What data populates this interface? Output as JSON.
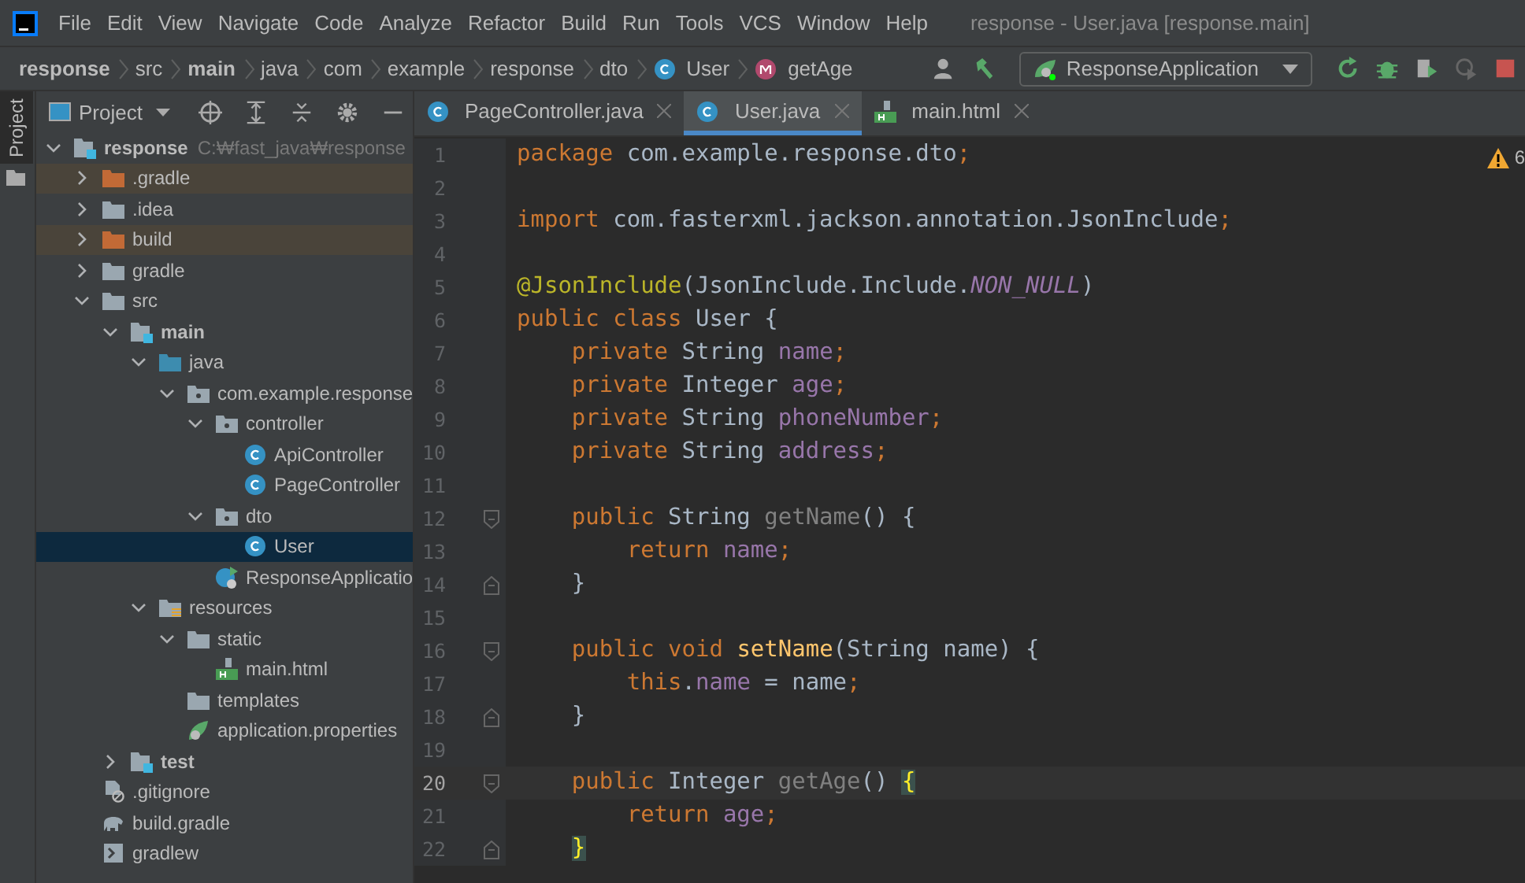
{
  "window": {
    "title": "response - User.java [response.main]"
  },
  "menu": [
    "File",
    "Edit",
    "View",
    "Navigate",
    "Code",
    "Analyze",
    "Refactor",
    "Build",
    "Run",
    "Tools",
    "VCS",
    "Window",
    "Help"
  ],
  "breadcrumbs": [
    {
      "label": "response",
      "bold": true
    },
    {
      "label": "src",
      "bold": false
    },
    {
      "label": "main",
      "bold": true
    },
    {
      "label": "java",
      "bold": false
    },
    {
      "label": "com",
      "bold": false
    },
    {
      "label": "example",
      "bold": false
    },
    {
      "label": "response",
      "bold": false
    },
    {
      "label": "dto",
      "bold": false
    },
    {
      "label": "User",
      "bold": false,
      "kind": "class"
    },
    {
      "label": "getAge",
      "bold": false,
      "kind": "method"
    }
  ],
  "run_config": {
    "label": "ResponseApplication"
  },
  "side_stripe": {
    "label": "Project",
    "selected": true
  },
  "project_panel": {
    "title": "Project",
    "tree": [
      {
        "label": "response",
        "bold": true,
        "hint": "C:₩fast_java₩response",
        "kind": "module",
        "expanded": true,
        "selected": false,
        "excluded": false,
        "children": [
          {
            "label": ".gradle",
            "kind": "folder",
            "excluded": true,
            "expanded": false,
            "selected": false
          },
          {
            "label": ".idea",
            "kind": "folder",
            "excluded": false,
            "expanded": false,
            "selected": false
          },
          {
            "label": "build",
            "kind": "folder",
            "excluded": true,
            "expanded": false,
            "selected": false
          },
          {
            "label": "gradle",
            "kind": "folder",
            "excluded": false,
            "expanded": false,
            "selected": false
          },
          {
            "label": "src",
            "kind": "folder",
            "excluded": false,
            "expanded": true,
            "selected": false,
            "children": [
              {
                "label": "main",
                "bold": true,
                "kind": "module",
                "excluded": false,
                "expanded": true,
                "selected": false,
                "children": [
                  {
                    "label": "java",
                    "kind": "source",
                    "excluded": false,
                    "expanded": true,
                    "selected": false,
                    "children": [
                      {
                        "label": "com.example.response",
                        "kind": "package",
                        "excluded": false,
                        "expanded": true,
                        "selected": false,
                        "children": [
                          {
                            "label": "controller",
                            "kind": "package",
                            "excluded": false,
                            "expanded": true,
                            "selected": false,
                            "children": [
                              {
                                "label": "ApiController",
                                "kind": "class",
                                "excluded": false,
                                "selected": false
                              },
                              {
                                "label": "PageController",
                                "kind": "class",
                                "excluded": false,
                                "selected": false
                              }
                            ]
                          },
                          {
                            "label": "dto",
                            "kind": "package",
                            "excluded": false,
                            "expanded": true,
                            "selected": false,
                            "children": [
                              {
                                "label": "User",
                                "kind": "class",
                                "excluded": false,
                                "selected": true
                              }
                            ]
                          },
                          {
                            "label": "ResponseApplicatio",
                            "kind": "spring-class",
                            "excluded": false,
                            "selected": false
                          }
                        ]
                      }
                    ]
                  },
                  {
                    "label": "resources",
                    "kind": "resources",
                    "excluded": false,
                    "expanded": true,
                    "selected": false,
                    "children": [
                      {
                        "label": "static",
                        "kind": "folder",
                        "excluded": false,
                        "expanded": true,
                        "selected": false,
                        "children": [
                          {
                            "label": "main.html",
                            "kind": "html",
                            "excluded": false,
                            "selected": false
                          }
                        ]
                      },
                      {
                        "label": "templates",
                        "kind": "folder",
                        "excluded": false,
                        "selected": false
                      },
                      {
                        "label": "application.properties",
                        "kind": "spring-props",
                        "excluded": false,
                        "selected": false
                      }
                    ]
                  }
                ]
              },
              {
                "label": "test",
                "bold": true,
                "kind": "module",
                "excluded": false,
                "expanded": false,
                "selected": false
              }
            ]
          },
          {
            "label": ".gitignore",
            "kind": "ignore",
            "excluded": false,
            "selected": false
          },
          {
            "label": "build.gradle",
            "kind": "gradle",
            "excluded": false,
            "selected": false
          },
          {
            "label": "gradlew",
            "kind": "script",
            "excluded": false,
            "selected": false
          }
        ]
      }
    ]
  },
  "tabs": [
    {
      "label": "PageController.java",
      "kind": "class",
      "selected": false
    },
    {
      "label": "User.java",
      "kind": "class",
      "selected": true
    },
    {
      "label": "main.html",
      "kind": "html",
      "selected": false
    }
  ],
  "warnings": "6",
  "code": [
    {
      "number": "1",
      "current": false,
      "kind": "normal",
      "tokens": [
        {
          "t": "package ",
          "kind": "kw"
        },
        {
          "t": "com.example.response.dto",
          "kind": "plain"
        },
        {
          "t": ";",
          "kind": "kw"
        }
      ]
    },
    {
      "number": "2",
      "current": false,
      "kind": "normal"
    },
    {
      "number": "3",
      "current": false,
      "kind": "normal",
      "tokens": [
        {
          "t": "import ",
          "kind": "kw"
        },
        {
          "t": "com.fasterxml.jackson.annotation.JsonInclude",
          "kind": "plain"
        },
        {
          "t": ";",
          "kind": "kw"
        }
      ]
    },
    {
      "number": "4",
      "current": false,
      "kind": "normal"
    },
    {
      "number": "5",
      "current": false,
      "kind": "normal",
      "tokens": [
        {
          "t": "@JsonInclude",
          "kind": "ann"
        },
        {
          "t": "(JsonInclude.Include.",
          "kind": "plain"
        },
        {
          "t": "NON_NULL",
          "kind": "const"
        },
        {
          "t": ")",
          "kind": "plain"
        }
      ]
    },
    {
      "number": "6",
      "current": false,
      "kind": "normal",
      "tokens": [
        {
          "t": "public class ",
          "kind": "kw"
        },
        {
          "t": "User {",
          "kind": "plain"
        }
      ]
    },
    {
      "number": "7",
      "current": false,
      "kind": "normal",
      "tokens": [
        {
          "t": "    private ",
          "kind": "kw"
        },
        {
          "t": "String ",
          "kind": "plain"
        },
        {
          "t": "name",
          "kind": "field"
        },
        {
          "t": ";",
          "kind": "kw"
        }
      ]
    },
    {
      "number": "8",
      "current": false,
      "kind": "normal",
      "tokens": [
        {
          "t": "    private ",
          "kind": "kw"
        },
        {
          "t": "Integer ",
          "kind": "plain"
        },
        {
          "t": "age",
          "kind": "field"
        },
        {
          "t": ";",
          "kind": "kw"
        }
      ]
    },
    {
      "number": "9",
      "current": false,
      "kind": "normal",
      "tokens": [
        {
          "t": "    private ",
          "kind": "kw"
        },
        {
          "t": "String ",
          "kind": "plain"
        },
        {
          "t": "phoneNumber",
          "kind": "field"
        },
        {
          "t": ";",
          "kind": "kw"
        }
      ]
    },
    {
      "number": "10",
      "current": false,
      "kind": "normal",
      "tokens": [
        {
          "t": "    private ",
          "kind": "kw"
        },
        {
          "t": "String ",
          "kind": "plain"
        },
        {
          "t": "address",
          "kind": "field"
        },
        {
          "t": ";",
          "kind": "kw"
        }
      ]
    },
    {
      "number": "11",
      "current": false,
      "kind": "normal"
    },
    {
      "number": "12",
      "current": false,
      "kind": "fold-start",
      "tokens": [
        {
          "t": "    public ",
          "kind": "kw"
        },
        {
          "t": "String ",
          "kind": "plain"
        },
        {
          "t": "getName",
          "kind": "unused"
        },
        {
          "t": "() {",
          "kind": "plain"
        }
      ]
    },
    {
      "number": "13",
      "current": false,
      "kind": "normal",
      "tokens": [
        {
          "t": "        return ",
          "kind": "kw"
        },
        {
          "t": "name",
          "kind": "field"
        },
        {
          "t": ";",
          "kind": "kw"
        }
      ]
    },
    {
      "number": "14",
      "current": false,
      "kind": "fold-end",
      "tokens": [
        {
          "t": "    }",
          "kind": "plain"
        }
      ]
    },
    {
      "number": "15",
      "current": false,
      "kind": "normal"
    },
    {
      "number": "16",
      "current": false,
      "kind": "fold-start",
      "tokens": [
        {
          "t": "    public void ",
          "kind": "kw"
        },
        {
          "t": "setName",
          "kind": "method"
        },
        {
          "t": "(String name) {",
          "kind": "plain"
        }
      ]
    },
    {
      "number": "17",
      "current": false,
      "kind": "normal",
      "tokens": [
        {
          "t": "        this",
          "kind": "kw"
        },
        {
          "t": ".",
          "kind": "plain"
        },
        {
          "t": "name",
          "kind": "field"
        },
        {
          "t": " = name",
          "kind": "plain"
        },
        {
          "t": ";",
          "kind": "kw"
        }
      ]
    },
    {
      "number": "18",
      "current": false,
      "kind": "fold-end",
      "tokens": [
        {
          "t": "    }",
          "kind": "plain"
        }
      ]
    },
    {
      "number": "19",
      "current": false,
      "kind": "normal"
    },
    {
      "number": "20",
      "current": true,
      "kind": "fold-start",
      "tokens": [
        {
          "t": "    public ",
          "kind": "kw"
        },
        {
          "t": "Integer ",
          "kind": "plain"
        },
        {
          "t": "getAge",
          "kind": "unused"
        },
        {
          "t": "() ",
          "kind": "plain"
        },
        {
          "t": "{",
          "kind": "brace"
        }
      ]
    },
    {
      "number": "21",
      "current": false,
      "kind": "normal",
      "tokens": [
        {
          "t": "        return ",
          "kind": "kw"
        },
        {
          "t": "age",
          "kind": "field"
        },
        {
          "t": ";",
          "kind": "kw"
        }
      ]
    },
    {
      "number": "22",
      "current": false,
      "kind": "fold-end",
      "tokens": [
        {
          "t": "    }",
          "kind": "brace"
        }
      ]
    }
  ]
}
